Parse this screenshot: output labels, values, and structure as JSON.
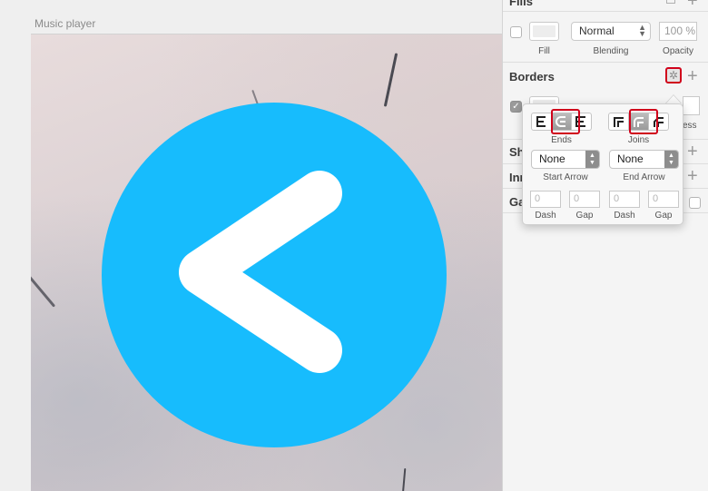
{
  "canvas": {
    "artboard_title": "Music player"
  },
  "inspector": {
    "fills": {
      "title": "Fills",
      "blending_value": "Normal",
      "opacity_value": "100 %",
      "labels": {
        "fill": "Fill",
        "blending": "Blending",
        "opacity": "Opacity"
      }
    },
    "borders": {
      "title": "Borders",
      "thickness_label_fragment": "ess"
    },
    "partial_rows": {
      "shadows": "Sh",
      "inner_shadows": "Inn",
      "gaussian": "Ga"
    }
  },
  "popover": {
    "ends_label": "Ends",
    "joins_label": "Joins",
    "start_arrow": {
      "value": "None",
      "label": "Start Arrow"
    },
    "end_arrow": {
      "value": "None",
      "label": "End Arrow"
    },
    "dash_fields": [
      {
        "value": "0",
        "label": "Dash"
      },
      {
        "value": "0",
        "label": "Gap"
      },
      {
        "value": "0",
        "label": "Dash"
      },
      {
        "value": "0",
        "label": "Gap"
      }
    ]
  },
  "colors": {
    "accent_blue": "#17bcfd",
    "highlight_red": "#d0021b"
  },
  "icons": {
    "back_icon": "chevron-left",
    "gear": "gear-icon"
  }
}
